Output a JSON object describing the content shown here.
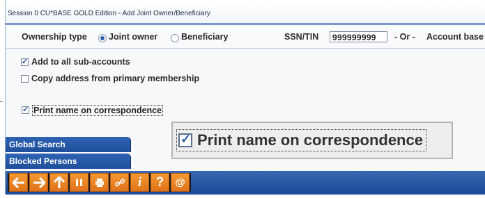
{
  "window": {
    "title": "Session 0 CU*BASE GOLD Edition - Add Joint Owner/Beneficiary"
  },
  "ownership": {
    "label": "Ownership type",
    "options": [
      {
        "label": "Joint owner",
        "selected": true
      },
      {
        "label": "Beneficiary",
        "selected": false
      }
    ]
  },
  "ssn": {
    "label": "SSN/TIN",
    "value": "999999999",
    "or_label": "- Or -",
    "account_base_label": "Account base"
  },
  "checkboxes": {
    "add_sub_accounts": {
      "label": "Add to all sub-accounts",
      "checked": true
    },
    "copy_address": {
      "label": "Copy address from primary membership",
      "checked": false
    },
    "print_name": {
      "label": "Print name on correspondence",
      "checked": true
    }
  },
  "zoom_callout": {
    "label": "Print name on correspondence"
  },
  "side_buttons": {
    "global_search": "Global Search",
    "blocked_persons": "Blocked Persons"
  },
  "toolbar": {
    "icons": [
      "back-arrow-icon",
      "forward-arrow-icon",
      "up-arrow-icon",
      "pause-icon",
      "print-icon",
      "link-icon",
      "info-icon",
      "help-icon",
      "at-icon"
    ],
    "glyphs": {
      "info": "i",
      "help": "?",
      "at": "@"
    }
  },
  "colors": {
    "accent_blue": "#1f4f9c",
    "toolbar_orange": "#f0892a",
    "title_band": "#7799cc"
  }
}
